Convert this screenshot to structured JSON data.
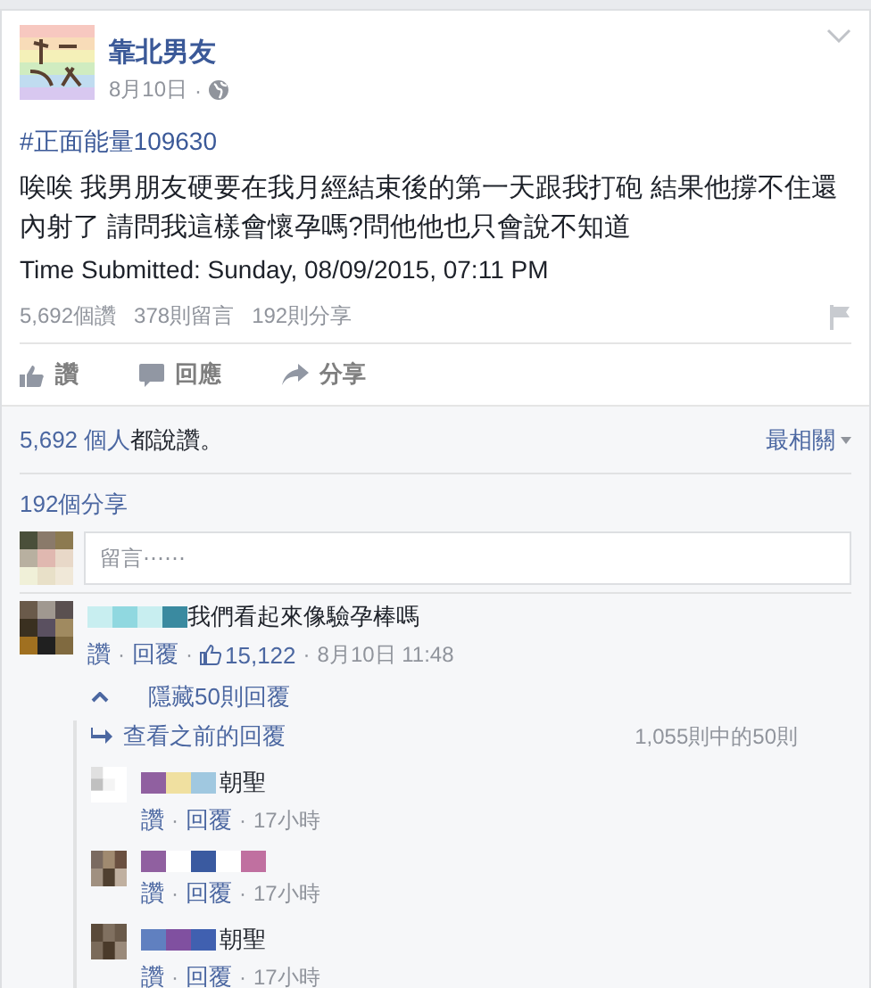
{
  "post": {
    "page_name": "靠北男友",
    "date": "8月10日",
    "date_separator": "·",
    "hashtag": "#正面能量109630",
    "body": "唉唉 我男朋友硬要在我月經結束後的第一天跟我打砲 結果他撐不住還內射了 請問我這樣會懷孕嗎?問他他也只會說不知道",
    "time_submitted": "Time Submitted: Sunday, 08/09/2015, 07:11 PM",
    "stats": [
      "5,692個讚",
      "378則留言",
      "192則分享"
    ]
  },
  "actions": [
    {
      "kind": "like",
      "label": "讚"
    },
    {
      "kind": "comment",
      "label": "回應"
    },
    {
      "kind": "share",
      "label": "分享"
    }
  ],
  "likes_summary": {
    "count": "5,692 個人",
    "suffix": "都說讚。",
    "sort": "最相關"
  },
  "shares_link": "192個分享",
  "comment_box": {
    "placeholder": "留言⋯⋯"
  },
  "meta_separator": "·",
  "comment": {
    "text": "我們看起來像驗孕棒嗎",
    "actions": [
      "讚",
      "回覆"
    ],
    "like_count": "15,122",
    "time": "8月10日 11:48"
  },
  "replies_toggle": {
    "hide": "隱藏50則回覆",
    "previous": "查看之前的回覆",
    "count": "1,055則中的50則"
  },
  "replies": [
    {
      "text": "朝聖",
      "actions": [
        "讚",
        "回覆"
      ],
      "time": "17小時"
    },
    {
      "actions": [
        "讚",
        "回覆"
      ],
      "time": "17小時"
    },
    {
      "text": "朝聖",
      "actions": [
        "讚",
        "回覆"
      ],
      "time": "17小時"
    }
  ]
}
